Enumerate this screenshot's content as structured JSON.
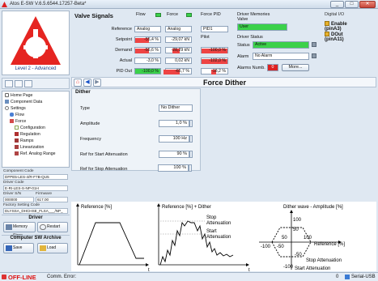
{
  "window": {
    "title": "Atos E-SW V.6.5.6544.17257-Beta*",
    "min": "_",
    "max": "□",
    "close": "✕"
  },
  "left": {
    "level": "Level 2 - Advanced",
    "tree": [
      {
        "label": "Home Page",
        "icon": "home-icon",
        "indent": 0
      },
      {
        "label": "Component Data",
        "icon": "component-data-icon",
        "indent": 0
      },
      {
        "label": "Settings",
        "icon": "settings-icon",
        "indent": 0
      },
      {
        "label": "Flow",
        "icon": "flow-icon",
        "indent": 1
      },
      {
        "label": "Force",
        "icon": "force-icon",
        "indent": 1
      },
      {
        "label": "Configuration",
        "icon": "configuration-icon",
        "indent": 2
      },
      {
        "label": "Regulation",
        "icon": "regulation-icon",
        "indent": 2
      },
      {
        "label": "Ramps",
        "icon": "ramps-icon",
        "indent": 2
      },
      {
        "label": "Linearization",
        "icon": "linearization-icon",
        "indent": 2
      },
      {
        "label": "Ref. Analog Range",
        "icon": "ref-analog-range-icon",
        "indent": 2
      }
    ],
    "component_code_label": "Component Code",
    "component_code": "DFPE5-LES-4/R-F7B-QU5",
    "driver_code_label": "Driver Code",
    "driver_code": "E-RI-LES-S-NP-01H",
    "driver_sn_label": "Driver S/N",
    "driver_sn": "000000",
    "firmware_label": "Firmware",
    "firmware": "617.00",
    "factory_label": "Factory Setting Code",
    "factory_code": "DLYSSA_DHCHSE_FLSA___/NP_",
    "driver_section": "Driver",
    "memory_store": "Memory Store",
    "restart": "Restart",
    "archive_section": "Computer SW Archive",
    "save": "Save",
    "load": "Load"
  },
  "valve_signals": {
    "title": "Valve Signals",
    "flow_hdr": "Flow",
    "force_hdr": "Force",
    "force_pid_hdr": "Force PID",
    "pilot_hdr": "Pilot",
    "rows": [
      {
        "label": "Reference",
        "flow": "Analog",
        "force": "Analog",
        "pid": "PID1"
      },
      {
        "label": "Setpoint",
        "flow": "-55,4 %",
        "force": "-29,07 kN",
        "pid": ""
      },
      {
        "label": "Demand",
        "flow": "-55,6 %",
        "force": "-28,29 kN",
        "pid": "-100,0 %"
      },
      {
        "label": "Actual",
        "flow": "-3,0 %",
        "force": "0,02 kN",
        "pid": "-102,0 %"
      },
      {
        "label": "PID Out",
        "flow": "-100,0 %",
        "force": "-65,7 %",
        "pid": "-18,2 %"
      }
    ]
  },
  "driver_memories": {
    "label": "Driver Memories",
    "valve_label": "Valve",
    "valve_value": "User"
  },
  "driver_status": {
    "label": "Driver Status",
    "status_label": "Status",
    "status_value": "Active",
    "alarm_label": "Alarm",
    "alarm_value": "No Alarm",
    "alarms_numb_label": "Alarms Numb.",
    "alarms_numb": "0",
    "more": "More..."
  },
  "digital_io": {
    "label": "Digital I/O",
    "enable": "Enable (pinA3)",
    "dout": "DOut (pinA11)"
  },
  "page": {
    "title": "Force Dither"
  },
  "dither": {
    "title": "Dither",
    "type_label": "Type",
    "type_value": "No Dither",
    "amplitude_label": "Amplitude",
    "amplitude_value": "1,0 %",
    "frequency_label": "Frequency",
    "frequency_value": "100 Hz",
    "ref_start_label": "Ref for Start Attenuation",
    "ref_start_value": "90 %",
    "ref_stop_label": "Ref for Stop Attenuation",
    "ref_stop_value": "100 %"
  },
  "graphs": {
    "g1_title": "Reference [%]",
    "g2_title": "Reference [%] + Dither",
    "g2_stop": "Stop",
    "g2_stop2": "Attenuation",
    "g2_start": "Start",
    "g2_start2": "Attenuation",
    "g3_title": "Dither wave - Amplitude [%]",
    "g3_ref": "Reference [%]",
    "g3_stop": "Stop Attenuation",
    "g3_start": "Start Attenuation",
    "t": "t",
    "v100": "100",
    "v50": "50",
    "vm50": "-50",
    "vm100": "-100",
    "h100": "100",
    "h50": "50",
    "hm50": "-50",
    "hm100": "-100"
  },
  "status_bar": {
    "offline": "OFF-LINE",
    "comm": "Comm. Error:",
    "count": "0",
    "port": "Serial-USB"
  }
}
